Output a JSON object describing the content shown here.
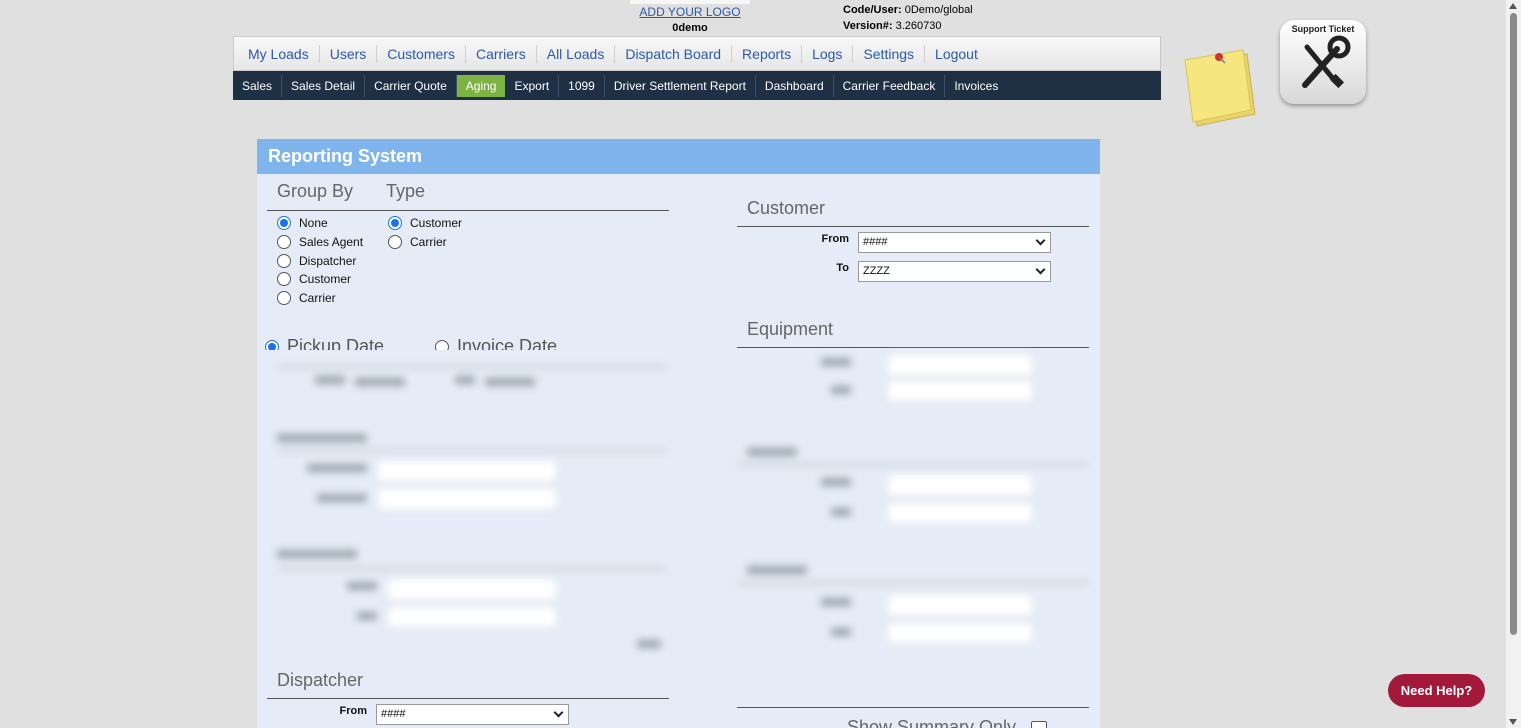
{
  "header": {
    "logo_link": "ADD YOUR LOGO",
    "company_code": "0demo",
    "code_user_label": "Code/User:",
    "code_user_value": "0Demo/global",
    "version_label": "Version#:",
    "version_value": "3.260730"
  },
  "nav_main": [
    "My Loads",
    "Users",
    "Customers",
    "Carriers",
    "All Loads",
    "Dispatch Board",
    "Reports",
    "Logs",
    "Settings",
    "Logout"
  ],
  "nav_sub": [
    "Sales",
    "Sales Detail",
    "Carrier Quote",
    "Aging",
    "Export",
    "1099",
    "Driver Settlement Report",
    "Dashboard",
    "Carrier Feedback",
    "Invoices"
  ],
  "nav_sub_active": "Aging",
  "support_ticket_label": "Support Ticket",
  "panel": {
    "title": "Reporting System",
    "group_by": {
      "title": "Group By",
      "options": [
        "None",
        "Sales Agent",
        "Dispatcher",
        "Customer",
        "Carrier"
      ],
      "selected": "None"
    },
    "type": {
      "title": "Type",
      "options": [
        "Customer",
        "Carrier"
      ],
      "selected": "Customer"
    },
    "date_basis": {
      "options": [
        "Pickup Date",
        "Invoice Date"
      ],
      "selected": "Pickup Date"
    },
    "customer": {
      "title": "Customer",
      "from_label": "From",
      "from_value": "####",
      "to_label": "To",
      "to_value": "ZZZZ"
    },
    "equipment": {
      "title": "Equipment"
    },
    "dispatcher": {
      "title": "Dispatcher",
      "from_label": "From",
      "from_value": "####"
    },
    "summary_label": "Show Summary Only"
  },
  "help_button": "Need Help?"
}
